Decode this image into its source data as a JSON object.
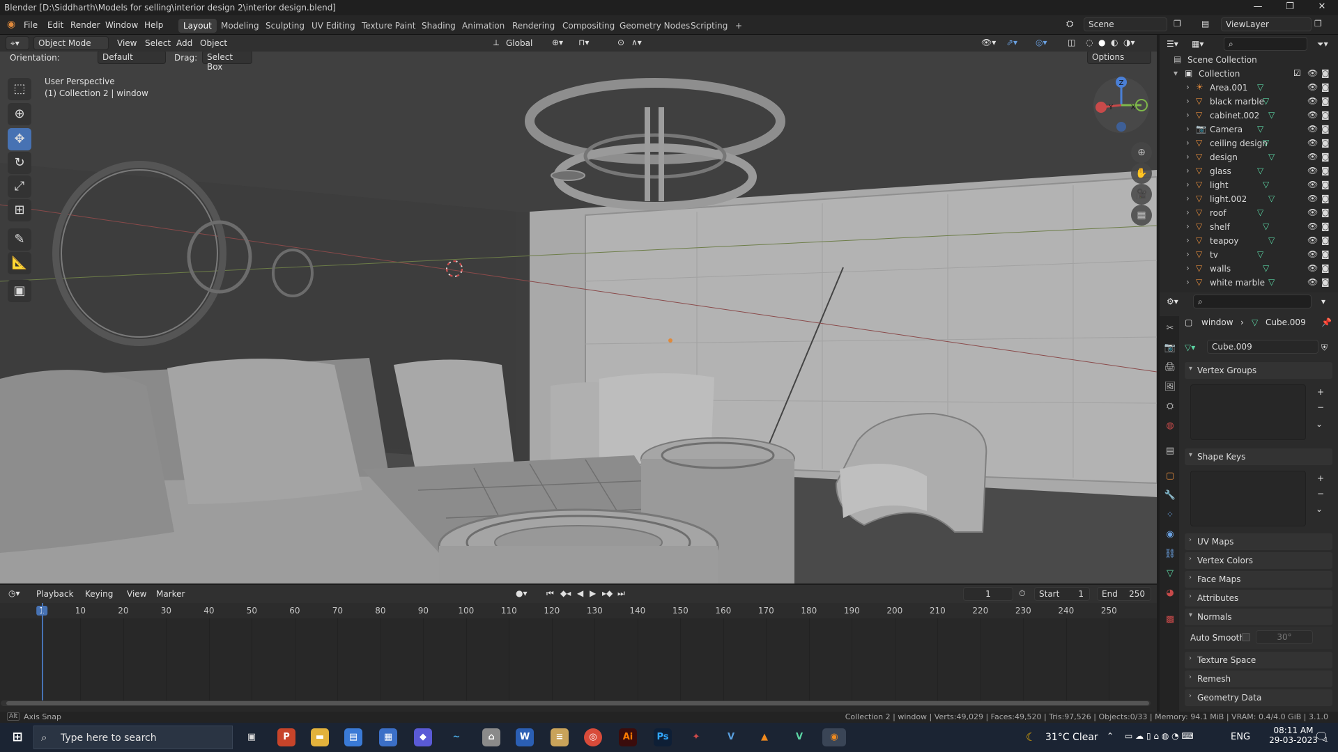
{
  "window": {
    "title": "Blender [D:\\Siddharth\\Models for selling\\interior design 2\\interior design.blend]",
    "minimize": "—",
    "maximize": "❐",
    "close": "✕"
  },
  "menus": [
    "File",
    "Edit",
    "Render",
    "Window",
    "Help"
  ],
  "workspaces": [
    "Layout",
    "Modeling",
    "Sculpting",
    "UV Editing",
    "Texture Paint",
    "Shading",
    "Animation",
    "Rendering",
    "Compositing",
    "Geometry Nodes",
    "Scripting",
    "+"
  ],
  "scene": {
    "scene_name": "Scene",
    "view_layer": "ViewLayer"
  },
  "viewport_header": {
    "mode": "Object Mode",
    "menus": [
      "View",
      "Select",
      "Add",
      "Object"
    ],
    "transform": "Global",
    "orientation_label": "Orientation:",
    "orientation_value": "Default",
    "drag_label": "Drag:",
    "drag_value": "Select Box",
    "options": "Options"
  },
  "viewport": {
    "perspective": "User Perspective",
    "collection_info": "(1) Collection 2 | window",
    "gizmo_axes": {
      "z": "Z",
      "y": "Y",
      "x": "X"
    }
  },
  "outliner": {
    "root": "Scene Collection",
    "collection": "Collection",
    "items": [
      "Area.001",
      "black marble",
      "cabinet.002",
      "Camera",
      "ceiling design",
      "design",
      "glass",
      "light",
      "light.002",
      "roof",
      "shelf",
      "teapoy",
      "tv",
      "walls",
      "white marble"
    ]
  },
  "properties": {
    "breadcrumb_object": "window",
    "breadcrumb_mesh": "Cube.009",
    "mesh_name": "Cube.009",
    "panels": {
      "vertex_groups": "Vertex Groups",
      "shape_keys": "Shape Keys",
      "uv_maps": "UV Maps",
      "vertex_colors": "Vertex Colors",
      "face_maps": "Face Maps",
      "attributes": "Attributes",
      "normals": "Normals",
      "auto_smooth_label": "Auto Smooth",
      "auto_smooth_angle": "30°",
      "texture_space": "Texture Space",
      "remesh": "Remesh",
      "geometry_data": "Geometry Data"
    }
  },
  "timeline": {
    "menus": [
      "Playback",
      "Keying",
      "View",
      "Marker"
    ],
    "current_frame": "1",
    "start_label": "Start",
    "start_value": "1",
    "end_label": "End",
    "end_value": "250",
    "ticks": [
      "1",
      "10",
      "20",
      "30",
      "40",
      "50",
      "60",
      "70",
      "80",
      "90",
      "100",
      "110",
      "120",
      "130",
      "140",
      "150",
      "160",
      "170",
      "180",
      "190",
      "200",
      "210",
      "220",
      "230",
      "240",
      "250"
    ]
  },
  "status": {
    "left": "Axis Snap",
    "right": "Collection 2 | window | Verts:49,029 | Faces:49,520 | Tris:97,526 | Objects:0/33 | Memory: 94.1 MiB | VRAM: 0.4/4.0 GiB | 3.1.0"
  },
  "taskbar": {
    "search_placeholder": "Type here to search",
    "weather": "31°C  Clear",
    "language": "ENG",
    "time": "08:11 AM",
    "date": "29-03-2023",
    "notifications": "1"
  },
  "colors": {
    "accent": "#4772b3",
    "active_frame": "#4772b3",
    "mesh_icon": "#e08a3c",
    "data_icon": "#5cd6a5"
  }
}
